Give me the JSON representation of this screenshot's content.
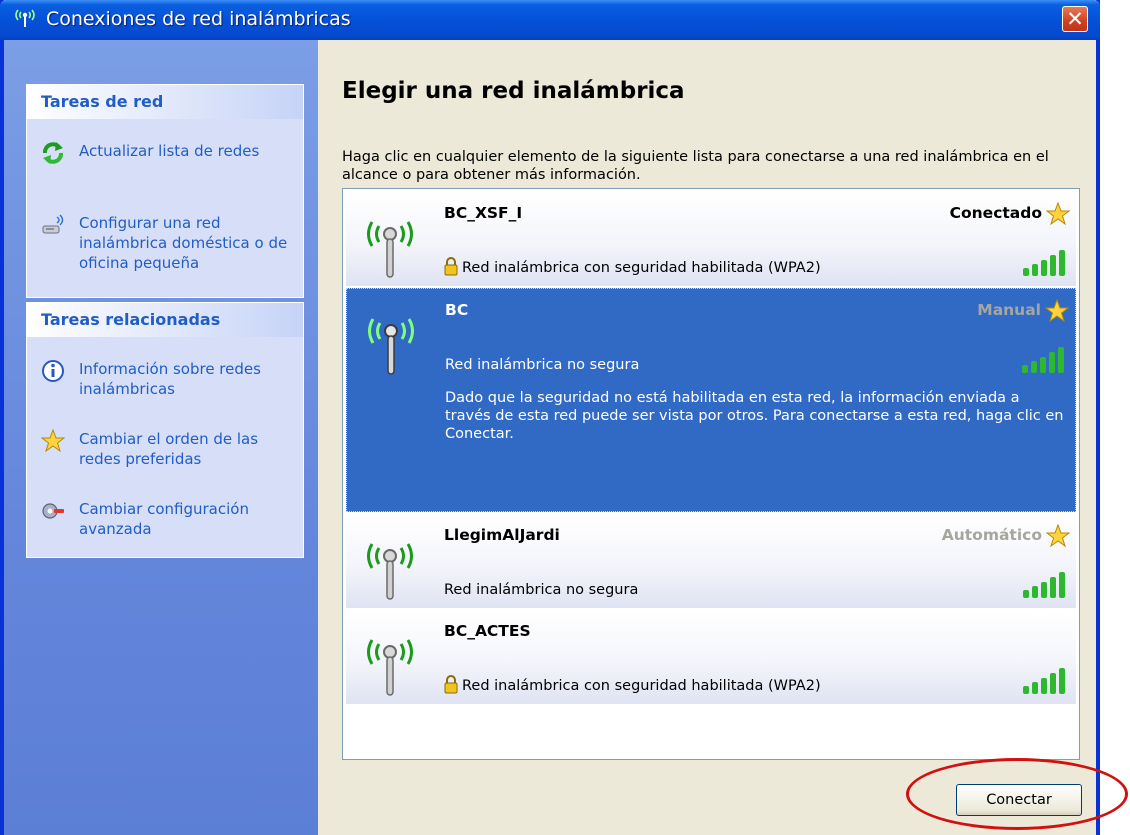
{
  "window": {
    "title": "Conexiones de red inalámbricas",
    "close_symbol": "✕"
  },
  "sidebar": {
    "network_tasks": {
      "header": "Tareas de red",
      "items": [
        {
          "label": "Actualizar lista de redes",
          "icon": "refresh-icon"
        },
        {
          "label": "Configurar una red inalámbrica doméstica o de oficina pequeña",
          "icon": "wireless-setup-icon"
        }
      ]
    },
    "related_tasks": {
      "header": "Tareas relacionadas",
      "items": [
        {
          "label": "Información sobre redes inalámbricas",
          "icon": "info-icon"
        },
        {
          "label": "Cambiar el orden de las redes preferidas",
          "icon": "star-icon"
        },
        {
          "label": "Cambiar configuración avanzada",
          "icon": "settings-icon"
        }
      ]
    }
  },
  "main": {
    "heading": "Elegir una red inalámbrica",
    "instructions": "Haga clic en cualquier elemento de la siguiente lista para conectarse a una red inalámbrica en el alcance o para obtener más información.",
    "networks": [
      {
        "ssid": "BC_XSF_I",
        "status": "Conectado",
        "security": "Red inalámbrica con seguridad habilitada (WPA2)",
        "secured": true,
        "signal_bars": 5
      },
      {
        "ssid": "BC",
        "status": "Manual",
        "security": "Red inalámbrica no segura",
        "secured": false,
        "signal_bars": 5,
        "selected": true,
        "description": "Dado que la seguridad no está habilitada en esta red, la información enviada a través de esta red puede ser vista por otros. Para conectarse a esta red, haga clic en Conectar."
      },
      {
        "ssid": "LlegimAlJardi",
        "status": "Automático",
        "security": "Red inalámbrica no segura",
        "secured": false,
        "signal_bars": 5
      },
      {
        "ssid": "BC_ACTES",
        "status": "",
        "security": "Red inalámbrica con seguridad habilitada (WPA2)",
        "secured": true,
        "signal_bars": 5
      }
    ],
    "connect_label": "Conectar"
  },
  "colors": {
    "titlebar": "#0551d8",
    "sidebar_background": "#6487dc",
    "selected_row": "#316ac5",
    "signal_green": "#2eb82e",
    "highlight_ring": "#d21010"
  }
}
